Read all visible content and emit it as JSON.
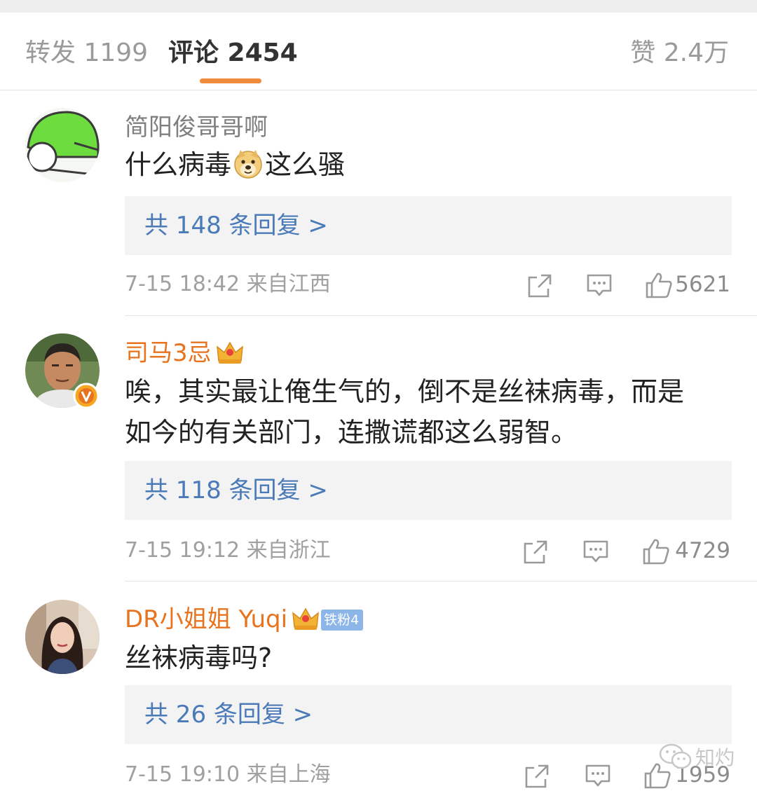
{
  "tabs": {
    "repost": "转发 1199",
    "comment": "评论 2454",
    "like": "赞 2.4万",
    "indicator_color": "#f08a3c"
  },
  "comments": [
    {
      "username": "简阳俊哥哥啊",
      "text_before_emoji": "什么病毒",
      "text_after_emoji": "这么骚",
      "emoji": "doge-emoji",
      "reply_link": "共 148 条回复 >",
      "meta": "7-15 18:42  来自江西",
      "likes": "5621"
    },
    {
      "username": "司马3忌",
      "verified": true,
      "text_line1": "唉，其实最让俺生气的，倒不是丝袜病毒，而是",
      "text_line2": "如今的有关部门，连撒谎都这么弱智。",
      "reply_link": "共 118 条回复 >",
      "meta": "7-15 19:12  来自浙江",
      "likes": "4729"
    },
    {
      "username": "DR小姐姐 Yuqi",
      "fan_badge": "铁粉4",
      "text": "丝袜病毒吗?",
      "reply_link": "共 26 条回复 >",
      "meta": "7-15 19:10  来自上海",
      "likes": "1959"
    }
  ],
  "watermark": "知灼",
  "colors": {
    "username_gold": "#e8731f",
    "reply_link": "#4a7ab8",
    "meta_gray": "#a0a0a0"
  }
}
